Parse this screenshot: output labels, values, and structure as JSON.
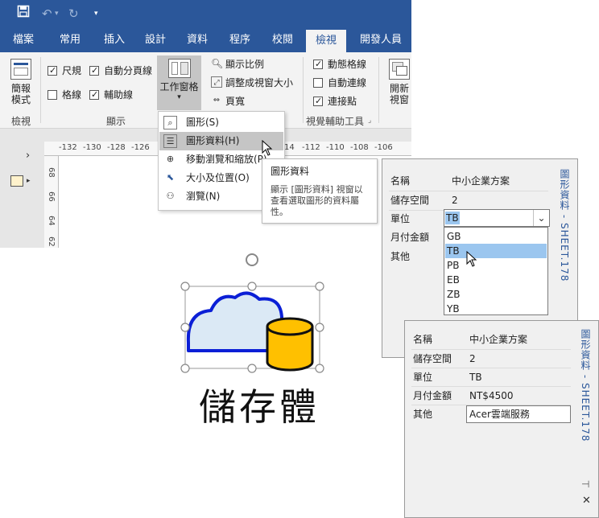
{
  "qat": {
    "save_icon": "save-icon",
    "undo_icon": "undo-icon",
    "redo_icon": "redo-icon",
    "customize_icon": "customize-qat-icon"
  },
  "tabs": [
    {
      "label": "檔案"
    },
    {
      "label": "常用"
    },
    {
      "label": "插入"
    },
    {
      "label": "設計"
    },
    {
      "label": "資料"
    },
    {
      "label": "程序"
    },
    {
      "label": "校閱"
    },
    {
      "label": "檢視",
      "active": true
    },
    {
      "label": "開發人員"
    }
  ],
  "ribbon": {
    "views": {
      "button_line1": "簡報",
      "button_line2": "模式",
      "group": "檢視"
    },
    "show": {
      "group": "顯示",
      "ruler": "尺規",
      "page_breaks": "自動分頁線",
      "grid": "格線",
      "guides": "輔助線",
      "ruler_checked": true,
      "page_breaks_checked": true,
      "grid_checked": false,
      "guides_checked": true
    },
    "task_panes": {
      "label": "工作窗格"
    },
    "zoom": {
      "zoom_ratio": "顯示比例",
      "fit_window": "調整成視窗大小",
      "page_width": "頁寬"
    },
    "visual_aids": {
      "group": "視覺輔助工具",
      "dynamic_grid": "動態格線",
      "auto_connect": "自動連線",
      "connection_points": "連接點",
      "dynamic_grid_checked": true,
      "auto_connect_checked": false,
      "connection_points_checked": true
    },
    "window": {
      "line1": "開新",
      "line2": "視窗"
    }
  },
  "ruler": {
    "top_ticks": [
      "-132",
      "-130",
      "-128",
      "-126",
      "14",
      "-112",
      "-110",
      "-108",
      "-106"
    ],
    "left_ticks": [
      "68",
      "66",
      "64",
      "62"
    ]
  },
  "task_pane_menu": [
    {
      "label": "圖形(S)",
      "icon": "shapes-icon"
    },
    {
      "label": "圖形資料(H)",
      "icon": "shape-data-icon",
      "highlighted": true
    },
    {
      "label": "移動瀏覽和縮放(P)",
      "icon": "pan-zoom-icon"
    },
    {
      "label": "大小及位置(O)",
      "icon": "size-position-icon"
    },
    {
      "label": "瀏覽(N)",
      "icon": "navigation-icon"
    }
  ],
  "tooltip": {
    "title": "圖形資料",
    "body": "顯示 [圖形資料] 視窗以查看選取圖形的資料屬性。"
  },
  "panel_back": {
    "title": "圖形資料 - SHEET.178",
    "rows": [
      {
        "key": "名稱",
        "value": "中小企業方案"
      },
      {
        "key": "儲存空間",
        "value": "2"
      },
      {
        "key": "單位",
        "value": "TB"
      },
      {
        "key": "月付金額",
        "value": ""
      },
      {
        "key": "其他",
        "value": ""
      }
    ],
    "dropdown_options": [
      "GB",
      "TB",
      "PB",
      "EB",
      "ZB",
      "YB"
    ],
    "selected_option": "TB"
  },
  "panel_front": {
    "title": "圖形資料 - SHEET.178",
    "rows": [
      {
        "key": "名稱",
        "value": "中小企業方案"
      },
      {
        "key": "儲存空間",
        "value": "2"
      },
      {
        "key": "單位",
        "value": "TB"
      },
      {
        "key": "月付金額",
        "value": "NT$4500"
      },
      {
        "key": "其他",
        "value": "Acer雲端服務"
      }
    ],
    "pin_icon": "pin-icon",
    "close_icon": "close-icon"
  },
  "shape": {
    "label": "儲存體",
    "cloud_fill": "#dbe9f5",
    "cloud_stroke": "#0b1fd6",
    "cylinder_fill": "#ffc000"
  },
  "colors": {
    "accent": "#2b579a",
    "selection": "#9bc6ef",
    "menu_highlight": "#c5c5c5"
  }
}
